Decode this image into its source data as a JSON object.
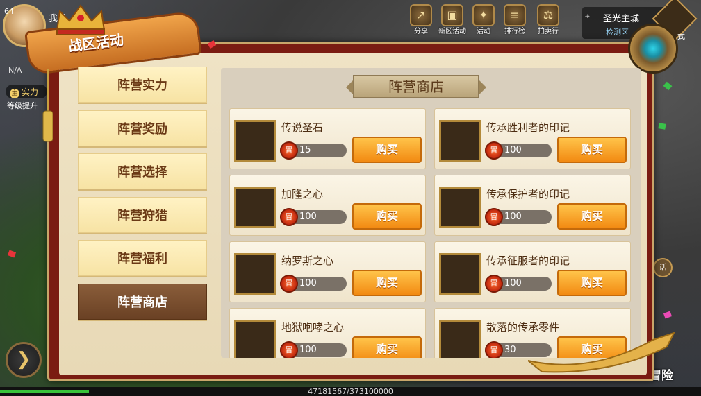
{
  "hud": {
    "level": "64",
    "player_name": "我是",
    "na_label": "N/A",
    "power_prefix": "主",
    "power_label": "实力",
    "level_hint": "等级提升",
    "top_buttons": [
      {
        "label": "分享",
        "icon": "share-icon"
      },
      {
        "label": "新区活动",
        "icon": "new-server-icon"
      },
      {
        "label": "活动",
        "icon": "gift-icon"
      },
      {
        "label": "排行榜",
        "icon": "ranking-icon"
      },
      {
        "label": "拍卖行",
        "icon": "auction-icon"
      }
    ],
    "location_city": "圣光主城",
    "location_sub": "检测区",
    "corner_label": "式",
    "side_label": "话",
    "adventure_label": "冒险",
    "exp_text": "47181567/373100000"
  },
  "panel": {
    "banner_title": "战区活动",
    "tabs": [
      {
        "label": "阵营实力",
        "active": false
      },
      {
        "label": "阵营奖励",
        "active": false
      },
      {
        "label": "阵营选择",
        "active": false
      },
      {
        "label": "阵营狩猎",
        "active": false
      },
      {
        "label": "阵营福利",
        "active": false
      },
      {
        "label": "阵营商店",
        "active": true
      }
    ],
    "shop_title": "阵营商店",
    "currency_glyph": "冒",
    "buy_label": "购买",
    "items": [
      {
        "name": "传说圣石",
        "price": "15",
        "icon": "amber-stone-icon"
      },
      {
        "name": "传承胜利者的印记",
        "price": "100",
        "icon": "victory-rune-icon"
      },
      {
        "name": "加隆之心",
        "price": "100",
        "icon": "cyan-heart-orb-icon"
      },
      {
        "name": "传承保护者的印记",
        "price": "100",
        "icon": "protector-rune-icon"
      },
      {
        "name": "纳罗斯之心",
        "price": "100",
        "icon": "dark-heart-orb-icon"
      },
      {
        "name": "传承征服者的印记",
        "price": "100",
        "icon": "conqueror-rune-icon"
      },
      {
        "name": "地狱咆哮之心",
        "price": "100",
        "icon": "red-heart-orb-icon"
      },
      {
        "name": "散落的传承零件",
        "price": "30",
        "icon": "gear-part-icon"
      }
    ]
  },
  "colors": {
    "accent_orange": "#f28a12",
    "tab_active": "#6a4124",
    "frame_red": "#7a1c12"
  }
}
